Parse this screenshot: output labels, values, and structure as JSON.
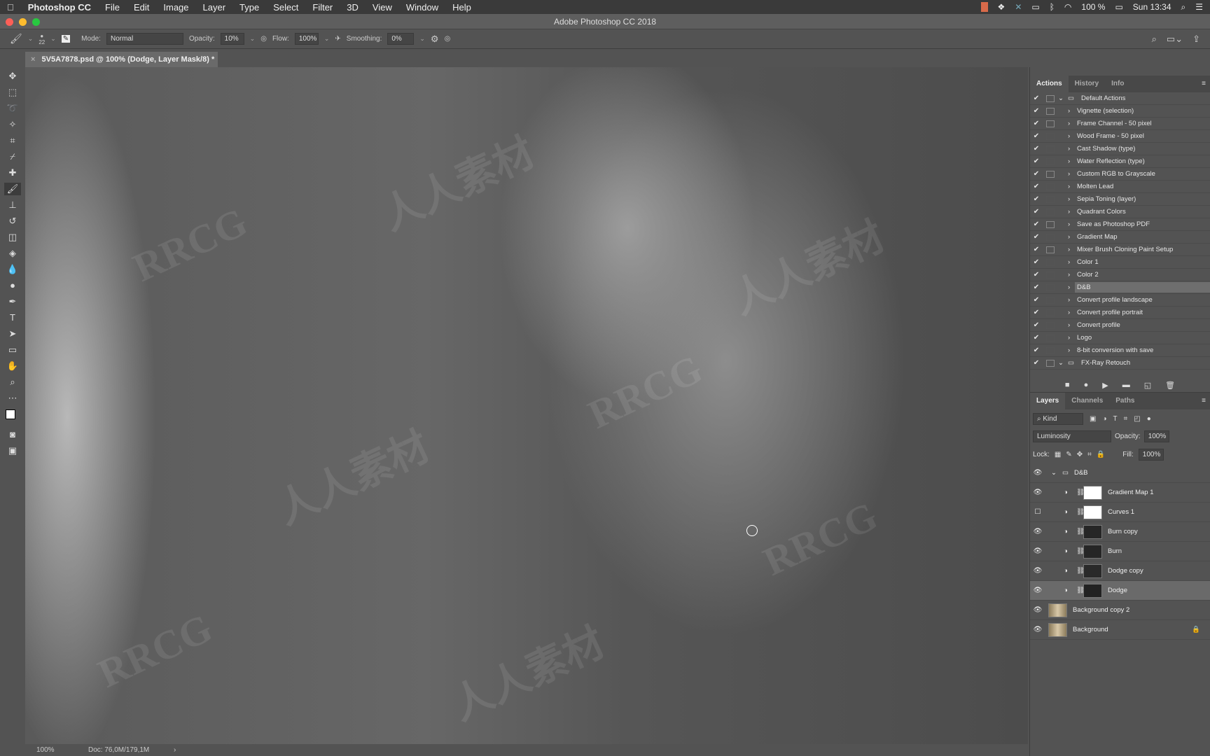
{
  "menubar": {
    "apple": "",
    "app": "Photoshop CC",
    "items": [
      "File",
      "Edit",
      "Image",
      "Layer",
      "Type",
      "Select",
      "Filter",
      "3D",
      "View",
      "Window",
      "Help"
    ],
    "battery": "100 %",
    "clock": "Sun 13:34"
  },
  "window": {
    "title": "Adobe Photoshop CC 2018"
  },
  "options": {
    "brush_size": "22",
    "mode_label": "Mode:",
    "mode": "Normal",
    "opacity_label": "Opacity:",
    "opacity": "10%",
    "flow_label": "Flow:",
    "flow": "100%",
    "smoothing_label": "Smoothing:",
    "smoothing": "0%"
  },
  "document": {
    "tab": "5V5A7878.psd @ 100% (Dodge, Layer Mask/8) *",
    "zoom": "100%",
    "doc_size": "Doc: 76,0M/179,1M"
  },
  "watermark": [
    "RRCG",
    "人人素材"
  ],
  "actions_panel": {
    "tabs": [
      "Actions",
      "History",
      "Info"
    ],
    "items": [
      {
        "label": "Default Actions",
        "folder": true,
        "dialog": true
      },
      {
        "label": "Vignette (selection)",
        "dialog": true
      },
      {
        "label": "Frame Channel - 50 pixel",
        "dialog": true
      },
      {
        "label": "Wood Frame - 50 pixel",
        "dialog": false
      },
      {
        "label": "Cast Shadow (type)",
        "dialog": false
      },
      {
        "label": "Water Reflection (type)",
        "dialog": false
      },
      {
        "label": "Custom RGB to Grayscale",
        "dialog": true
      },
      {
        "label": "Molten Lead",
        "dialog": false
      },
      {
        "label": "Sepia Toning (layer)",
        "dialog": false
      },
      {
        "label": "Quadrant Colors",
        "dialog": false
      },
      {
        "label": "Save as Photoshop PDF",
        "dialog": true
      },
      {
        "label": "Gradient Map",
        "dialog": false
      },
      {
        "label": "Mixer Brush Cloning Paint Setup",
        "dialog": true
      },
      {
        "label": "Color 1",
        "dialog": false
      },
      {
        "label": "Color 2",
        "dialog": false
      },
      {
        "label": "D&B",
        "dialog": false,
        "selected": true
      },
      {
        "label": "Convert profile landscape",
        "dialog": false
      },
      {
        "label": "Convert profile portrait",
        "dialog": false
      },
      {
        "label": "Convert profile",
        "dialog": false
      },
      {
        "label": "Logo",
        "dialog": false
      },
      {
        "label": "8-bit conversion with save",
        "dialog": false
      },
      {
        "label": "FX-Ray Retouch",
        "folder": true,
        "dialog": true
      }
    ]
  },
  "layers_panel": {
    "tabs": [
      "Layers",
      "Channels",
      "Paths"
    ],
    "filter": "Kind",
    "blend_mode": "Luminosity",
    "opacity_label": "Opacity:",
    "opacity": "100%",
    "lock_label": "Lock:",
    "fill_label": "Fill:",
    "fill": "100%",
    "layers": [
      {
        "name": "D&B",
        "type": "group",
        "visible": true
      },
      {
        "name": "Gradient Map 1",
        "type": "adjustment",
        "visible": true,
        "mask": "#ffffff"
      },
      {
        "name": "Curves 1",
        "type": "adjustment",
        "visible": false,
        "mask": "#ffffff"
      },
      {
        "name": "Burn copy",
        "type": "adjustment",
        "visible": true,
        "mask": "#262626"
      },
      {
        "name": "Burn",
        "type": "adjustment",
        "visible": true,
        "mask": "#262626"
      },
      {
        "name": "Dodge copy",
        "type": "adjustment",
        "visible": true,
        "mask": "#2a2a2a"
      },
      {
        "name": "Dodge",
        "type": "adjustment",
        "visible": true,
        "mask": "#222222",
        "selected": true
      },
      {
        "name": "Background copy 2",
        "type": "pixel",
        "visible": true
      },
      {
        "name": "Background",
        "type": "pixel",
        "visible": true,
        "locked": true
      }
    ]
  }
}
